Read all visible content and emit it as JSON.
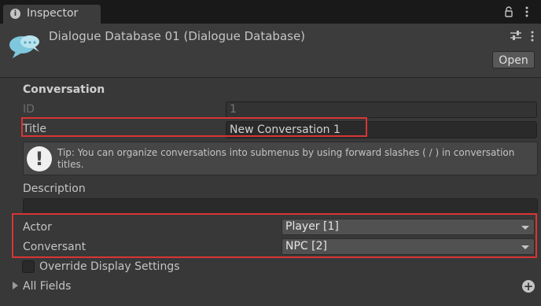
{
  "tab": {
    "label": "Inspector",
    "info_icon": "info-icon",
    "lock_icon": "lock-icon",
    "menu_icon": "kebab-menu-icon"
  },
  "header": {
    "asset_title": "Dialogue Database 01 (Dialogue Database)",
    "asset_icon": "speech-bubbles-icon",
    "open_label": "Open"
  },
  "conversation": {
    "section_title": "Conversation",
    "id_label": "ID",
    "id_value": "1",
    "title_label": "Title",
    "title_value": "New Conversation 1",
    "tip_text": "Tip: You can organize conversations into submenus by using forward slashes ( / ) in conversation titles.",
    "description_label": "Description",
    "description_value": "",
    "actor_label": "Actor",
    "actor_value": "Player [1]",
    "conversant_label": "Conversant",
    "conversant_value": "NPC [2]",
    "override_label": "Override Display Settings",
    "override_checked": false,
    "all_fields_label": "All Fields"
  },
  "colors": {
    "highlight": "#d83535",
    "panel": "#383838",
    "tab_bar": "#191919"
  }
}
